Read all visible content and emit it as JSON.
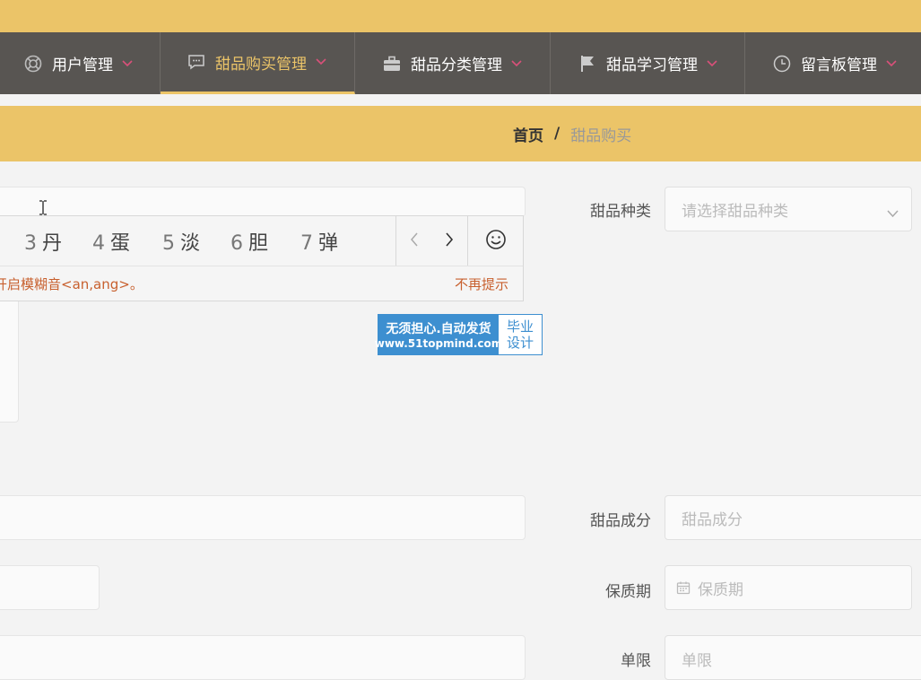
{
  "nav": {
    "items": [
      {
        "label": "用户管理",
        "icon": "lifebuoy-icon"
      },
      {
        "label": "甜品购买管理",
        "icon": "message-icon",
        "active": true
      },
      {
        "label": "甜品分类管理",
        "icon": "briefcase-icon"
      },
      {
        "label": "甜品学习管理",
        "icon": "flag-icon"
      },
      {
        "label": "留言板管理",
        "icon": "clock-icon"
      }
    ]
  },
  "breadcrumb": {
    "home": "首页",
    "separator": "/",
    "current": "甜品购买"
  },
  "ime": {
    "candidates": [
      {
        "num": "3",
        "char": "丹"
      },
      {
        "num": "4",
        "char": "蛋"
      },
      {
        "num": "5",
        "char": "淡"
      },
      {
        "num": "6",
        "char": "胆"
      },
      {
        "num": "7",
        "char": "弹"
      }
    ],
    "tip": "开启模糊音<an,ang>。",
    "dismiss": "不再提示"
  },
  "watermark": {
    "line1": "无须担心.自动发货",
    "line2": "www.51topmind.com",
    "right1": "毕业",
    "right2": "设计"
  },
  "form": {
    "category_label": "甜品种类",
    "category_placeholder": "请选择甜品种类",
    "ingredient_label": "甜品成分",
    "ingredient_placeholder": "甜品成分",
    "shelf_label": "保质期",
    "shelf_placeholder": "保质期",
    "limit_label": "单限",
    "limit_placeholder": "单限"
  },
  "colors": {
    "accent": "#ebc468",
    "nav_bg": "#585552",
    "chevron": "#d9507a"
  }
}
